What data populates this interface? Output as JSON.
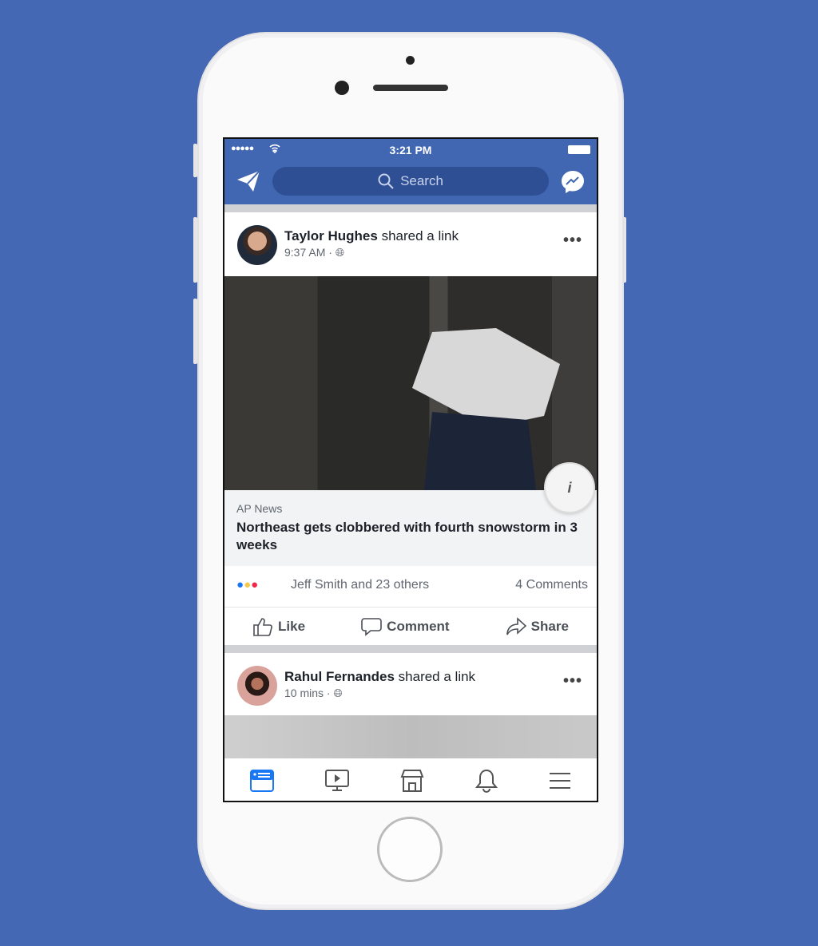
{
  "status": {
    "time": "3:21 PM",
    "signal": "●●●●●"
  },
  "search": {
    "placeholder": "Search"
  },
  "posts": [
    {
      "author": "Taylor Hughes",
      "action": "shared a link",
      "time": "9:37 AM ·",
      "link": {
        "source": "AP News",
        "title": "Northeast gets clobbered with fourth snowstorm in 3 weeks"
      },
      "reactions": "Jeff Smith and 23 others",
      "comments": "4 Comments"
    },
    {
      "author": "Rahul Fernandes",
      "action": "shared a link",
      "time": "10 mins ·"
    }
  ],
  "actions": {
    "like": "Like",
    "comment": "Comment",
    "share": "Share"
  },
  "tabs": [
    "news-feed",
    "watch",
    "marketplace",
    "notifications",
    "menu"
  ],
  "colors": {
    "brand": "#4267b2",
    "background": "#4468b4"
  }
}
